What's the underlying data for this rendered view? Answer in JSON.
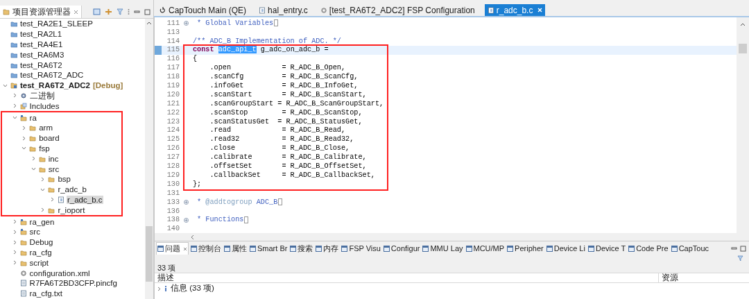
{
  "explorer": {
    "title": "项目资源管理器",
    "tree": [
      {
        "kind": "closed-project",
        "label": "test_RA2E1_SLEEP",
        "selected": false
      },
      {
        "kind": "closed-project",
        "label": "test_RA2L1",
        "selected": false
      },
      {
        "kind": "closed-project",
        "label": "test_RA4E1",
        "selected": false
      },
      {
        "kind": "closed-project",
        "label": "test_RA6M3",
        "selected": false
      },
      {
        "kind": "closed-project",
        "label": "test_RA6T2",
        "selected": false
      },
      {
        "kind": "closed-project",
        "label": "test_RA6T2_ADC",
        "selected": false
      },
      {
        "kind": "project",
        "label": "test_RA6T2_ADC2",
        "decoration": "[Debug]",
        "expanded": true,
        "selected": false,
        "children": [
          {
            "kind": "binaries",
            "label": "二进制",
            "expanded": false,
            "selected": false
          },
          {
            "kind": "includes",
            "label": "Includes",
            "expanded": false,
            "selected": false
          },
          {
            "kind": "source-folder",
            "label": "ra",
            "expanded": true,
            "selected": false,
            "highlighted": true,
            "children": [
              {
                "kind": "folder",
                "label": "arm",
                "expanded": false,
                "selected": false
              },
              {
                "kind": "folder",
                "label": "board",
                "expanded": false,
                "selected": false
              },
              {
                "kind": "folder",
                "label": "fsp",
                "expanded": true,
                "selected": false,
                "children": [
                  {
                    "kind": "folder",
                    "label": "inc",
                    "expanded": false,
                    "selected": false
                  },
                  {
                    "kind": "folder",
                    "label": "src",
                    "expanded": true,
                    "selected": false,
                    "children": [
                      {
                        "kind": "folder",
                        "label": "bsp",
                        "expanded": false,
                        "selected": false
                      },
                      {
                        "kind": "folder",
                        "label": "r_adc_b",
                        "expanded": true,
                        "selected": false,
                        "children": [
                          {
                            "kind": "file",
                            "label": "r_adc_b.c",
                            "expanded": false,
                            "selected": true
                          }
                        ]
                      },
                      {
                        "kind": "folder",
                        "label": "r_ioport",
                        "expanded": false,
                        "selected": false
                      }
                    ]
                  }
                ]
              }
            ]
          },
          {
            "kind": "source-folder",
            "label": "ra_gen",
            "expanded": false,
            "selected": false
          },
          {
            "kind": "source-folder",
            "label": "src",
            "expanded": false,
            "selected": false
          },
          {
            "kind": "folder",
            "label": "Debug",
            "expanded": false,
            "selected": false
          },
          {
            "kind": "folder",
            "label": "ra_cfg",
            "expanded": false,
            "selected": false
          },
          {
            "kind": "folder",
            "label": "script",
            "expanded": false,
            "selected": false
          },
          {
            "kind": "config",
            "label": "configuration.xml",
            "selected": false
          },
          {
            "kind": "text-file",
            "label": "R7FA6T2BD3CFP.pincfg",
            "selected": false
          },
          {
            "kind": "text-file",
            "label": "ra_cfg.txt",
            "selected": false
          }
        ]
      }
    ]
  },
  "editor": {
    "tabs": [
      {
        "kind": "captouch",
        "label": "CapTouch Main (QE)",
        "selected": false
      },
      {
        "kind": "c-file",
        "label": "hal_entry.c",
        "selected": false
      },
      {
        "kind": "config",
        "label": "[test_RA6T2_ADC2] FSP Configuration",
        "selected": false
      },
      {
        "kind": "c-file",
        "label": "r_adc_b.c",
        "selected": true
      }
    ],
    "lines": [
      {
        "number": "111",
        "folded": true,
        "current": false,
        "segments": [
          {
            "kind": "doc",
            "text": " * Global Variables"
          }
        ]
      },
      {
        "number": "113",
        "folded": false,
        "current": false
      },
      {
        "number": "114",
        "folded": false,
        "current": false,
        "segments": [
          {
            "kind": "doc",
            "text": "/** ADC_B Implementation of ADC. */"
          }
        ]
      },
      {
        "number": "115",
        "folded": false,
        "current": true,
        "segments": [
          {
            "kind": "keyword",
            "text": "const "
          },
          {
            "kind": "selected",
            "text": "adc_api_t"
          },
          {
            "kind": "plain",
            "text": " g_adc_on_adc_b ="
          }
        ]
      },
      {
        "number": "116",
        "folded": false,
        "current": false,
        "segments": [
          {
            "kind": "plain",
            "text": "{"
          }
        ]
      },
      {
        "number": "117",
        "folded": false,
        "current": false,
        "segments": [
          {
            "kind": "plain",
            "text": "    .open            = R_ADC_B_Open,"
          }
        ]
      },
      {
        "number": "118",
        "folded": false,
        "current": false,
        "segments": [
          {
            "kind": "plain",
            "text": "    .scanCfg         = R_ADC_B_ScanCfg,"
          }
        ]
      },
      {
        "number": "119",
        "folded": false,
        "current": false,
        "segments": [
          {
            "kind": "plain",
            "text": "    .infoGet         = R_ADC_B_InfoGet,"
          }
        ]
      },
      {
        "number": "120",
        "folded": false,
        "current": false,
        "segments": [
          {
            "kind": "plain",
            "text": "    .scanStart       = R_ADC_B_ScanStart,"
          }
        ]
      },
      {
        "number": "121",
        "folded": false,
        "current": false,
        "segments": [
          {
            "kind": "plain",
            "text": "    .scanGroupStart = R_ADC_B_ScanGroupStart,"
          }
        ]
      },
      {
        "number": "122",
        "folded": false,
        "current": false,
        "segments": [
          {
            "kind": "plain",
            "text": "    .scanStop        = R_ADC_B_ScanStop,"
          }
        ]
      },
      {
        "number": "123",
        "folded": false,
        "current": false,
        "segments": [
          {
            "kind": "plain",
            "text": "    .scanStatusGet  = R_ADC_B_StatusGet,"
          }
        ]
      },
      {
        "number": "124",
        "folded": false,
        "current": false,
        "segments": [
          {
            "kind": "plain",
            "text": "    .read            = R_ADC_B_Read,"
          }
        ]
      },
      {
        "number": "125",
        "folded": false,
        "current": false,
        "segments": [
          {
            "kind": "plain",
            "text": "    .read32          = R_ADC_B_Read32,"
          }
        ]
      },
      {
        "number": "126",
        "folded": false,
        "current": false,
        "segments": [
          {
            "kind": "plain",
            "text": "    .close           = R_ADC_B_Close,"
          }
        ]
      },
      {
        "number": "127",
        "folded": false,
        "current": false,
        "segments": [
          {
            "kind": "plain",
            "text": "    .calibrate       = R_ADC_B_Calibrate,"
          }
        ]
      },
      {
        "number": "128",
        "folded": false,
        "current": false,
        "segments": [
          {
            "kind": "plain",
            "text": "    .offsetSet       = R_ADC_B_OffsetSet,"
          }
        ]
      },
      {
        "number": "129",
        "folded": false,
        "current": false,
        "segments": [
          {
            "kind": "plain",
            "text": "    .callbackSet     = R_ADC_B_CallbackSet,"
          }
        ]
      },
      {
        "number": "130",
        "folded": false,
        "current": false,
        "segments": [
          {
            "kind": "plain",
            "text": "};"
          }
        ]
      },
      {
        "number": "131",
        "folded": false,
        "current": false
      },
      {
        "number": "133",
        "folded": true,
        "current": false,
        "segments": [
          {
            "kind": "doc",
            "text": " * "
          },
          {
            "kind": "doc-tag",
            "text": "@addtogroup"
          },
          {
            "kind": "doc",
            "text": " ADC_B"
          }
        ]
      },
      {
        "number": "136",
        "folded": false,
        "current": false
      },
      {
        "number": "138",
        "folded": true,
        "current": false,
        "segments": [
          {
            "kind": "doc",
            "text": " * Functions"
          }
        ]
      },
      {
        "number": "140",
        "folded": false,
        "current": false
      }
    ]
  },
  "bottom_panel": {
    "tabs": [
      {
        "label": "问题",
        "selected": true
      },
      {
        "label": "控制台",
        "selected": false
      },
      {
        "label": "属性",
        "selected": false
      },
      {
        "label": "Smart Br",
        "selected": false
      },
      {
        "label": "搜索",
        "selected": false
      },
      {
        "label": "内存",
        "selected": false
      },
      {
        "label": "FSP Visu",
        "selected": false
      },
      {
        "label": "Configur",
        "selected": false
      },
      {
        "label": "MMU Lay",
        "selected": false
      },
      {
        "label": "MCU/MP",
        "selected": false
      },
      {
        "label": "Peripher",
        "selected": false
      },
      {
        "label": "Device Li",
        "selected": false
      },
      {
        "label": "Device T",
        "selected": false
      },
      {
        "label": "Code Pre",
        "selected": false
      },
      {
        "label": "CapTouc",
        "selected": false
      }
    ],
    "summary": "33 项",
    "columns": [
      "描述",
      "资源"
    ],
    "rows": [
      {
        "label": "信息 (33 项)",
        "expanded": false
      }
    ]
  }
}
